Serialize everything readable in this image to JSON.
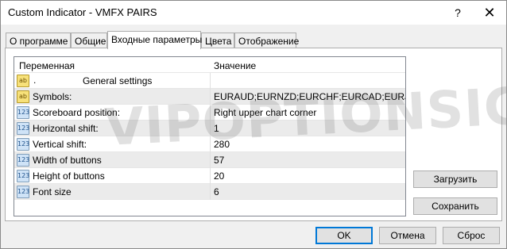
{
  "window": {
    "title": "Custom Indicator - VMFX PAIRS",
    "help": "?",
    "close": "✕"
  },
  "tabs": [
    {
      "label": "О программе"
    },
    {
      "label": "Общие"
    },
    {
      "label": "Входные параметры"
    },
    {
      "label": "Цвета"
    },
    {
      "label": "Отображение"
    }
  ],
  "grid": {
    "header": {
      "variable": "Переменная",
      "value": "Значение"
    },
    "rows": [
      {
        "icon": "ab",
        "dot": ".",
        "name": "General settings",
        "value": ""
      },
      {
        "icon": "ab",
        "name": "Symbols:",
        "value": "EURAUD;EURNZD;EURCHF;EURCAD;EURJP..."
      },
      {
        "icon": "123",
        "name": "Scoreboard position:",
        "value": "Right upper chart corner"
      },
      {
        "icon": "123",
        "name": "Horizontal shift:",
        "value": "1"
      },
      {
        "icon": "123",
        "name": "Vertical shift:",
        "value": "280"
      },
      {
        "icon": "123",
        "name": "Width of buttons",
        "value": "57"
      },
      {
        "icon": "123",
        "name": "Height of buttons",
        "value": "20"
      },
      {
        "icon": "123",
        "name": "Font size",
        "value": "6"
      }
    ]
  },
  "side_buttons": {
    "load": "Загрузить",
    "save": "Сохранить"
  },
  "bottom_buttons": {
    "ok": "OK",
    "cancel": "Отмена",
    "reset": "Сброс"
  },
  "watermark": "VIPOPTIONSIGNALS.COM"
}
